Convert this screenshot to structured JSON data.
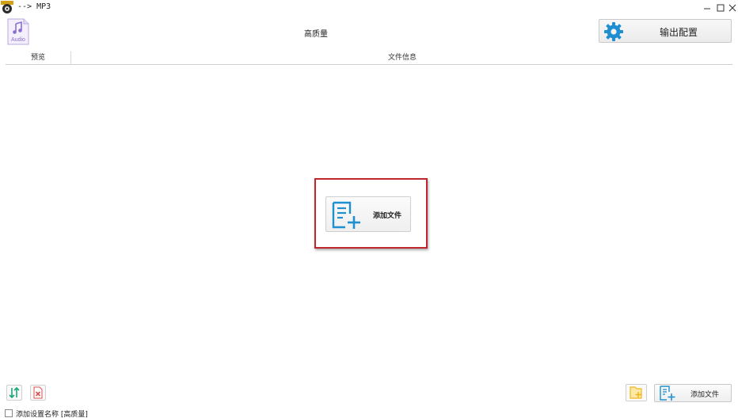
{
  "window": {
    "title": "--> MP3",
    "minimize_glyph": "_",
    "maximize_glyph": "□",
    "close_glyph": "✕"
  },
  "header": {
    "format_icon_label": "Audio",
    "profile_title": "高质量",
    "output_config_label": "输出配置"
  },
  "list": {
    "columns": [
      "预览",
      "文件信息"
    ]
  },
  "center_add": {
    "label": "添加文件"
  },
  "bottom": {
    "add_file_label": "添加文件",
    "checkbox_label": "添加设置名称 [高质量]",
    "checkbox_checked": false
  },
  "colors": {
    "accent_blue": "#1e8fd0",
    "highlight_red": "#c0262d",
    "audio_purple": "#9b7fd4",
    "folder_yellow": "#f2b51e"
  },
  "icons": {
    "app": "app-icon",
    "audio": "audio-file-icon",
    "gear": "gear-icon",
    "add_file": "add-file-icon",
    "sort": "sort-icon",
    "delete": "delete-icon",
    "folder": "add-folder-icon"
  }
}
